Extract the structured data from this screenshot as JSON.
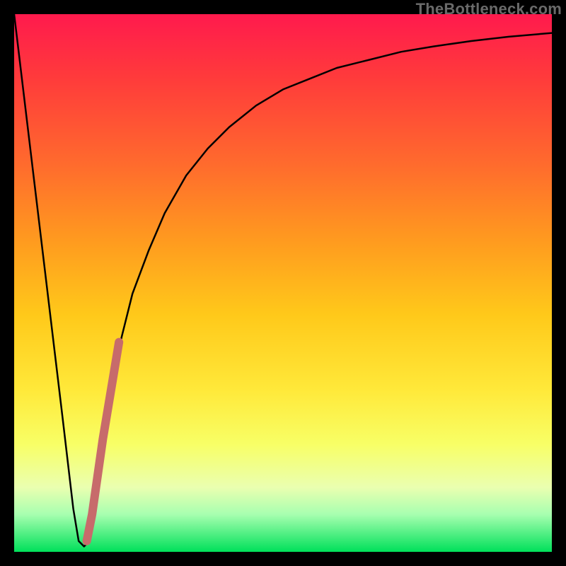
{
  "watermark": "TheBottleneck.com",
  "chart_data": {
    "type": "line",
    "title": "",
    "xlabel": "",
    "ylabel": "",
    "xlim": [
      0,
      100
    ],
    "ylim": [
      0,
      100
    ],
    "series": [
      {
        "name": "bottleneck-curve",
        "x": [
          0,
          3,
          6,
          9,
          11,
          12,
          13,
          14,
          15,
          16,
          18,
          20,
          22,
          25,
          28,
          32,
          36,
          40,
          45,
          50,
          55,
          60,
          66,
          72,
          78,
          85,
          92,
          100
        ],
        "values": [
          100,
          75,
          50,
          25,
          8,
          2,
          1,
          2,
          8,
          18,
          30,
          40,
          48,
          56,
          63,
          70,
          75,
          79,
          83,
          86,
          88,
          90,
          91.5,
          93,
          94,
          95,
          95.8,
          96.5
        ]
      },
      {
        "name": "highlight-segment",
        "x": [
          13.5,
          14.5,
          15.5,
          16.5,
          17.5,
          18.5,
          19.5
        ],
        "values": [
          2,
          7,
          14,
          21,
          27,
          33,
          39
        ]
      }
    ],
    "colors": {
      "curve": "#000000",
      "highlight": "#c76b6b"
    }
  }
}
